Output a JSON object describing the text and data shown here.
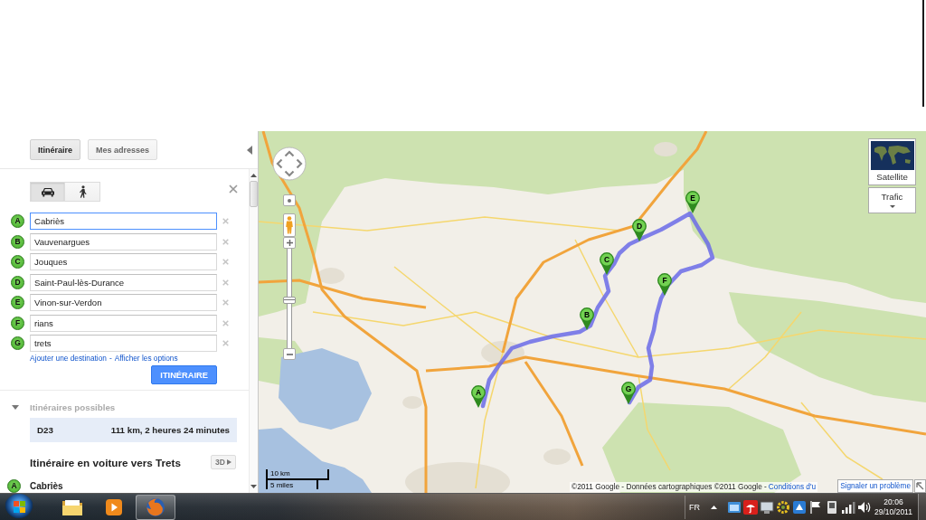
{
  "sidebar": {
    "tabs": [
      {
        "label": "Itinéraire",
        "selected": true
      },
      {
        "label": "Mes adresses",
        "selected": false
      }
    ],
    "travel_modes": [
      {
        "kind": "car",
        "selected": true
      },
      {
        "kind": "walk",
        "selected": false
      }
    ],
    "waypoints": [
      {
        "marker": "A",
        "value": "Cabriès",
        "focused": true
      },
      {
        "marker": "B",
        "value": "Vauvenargues",
        "focused": false
      },
      {
        "marker": "C",
        "value": "Jouques",
        "focused": false
      },
      {
        "marker": "D",
        "value": "Saint-Paul-lès-Durance",
        "focused": false
      },
      {
        "marker": "E",
        "value": "Vinon-sur-Verdon",
        "focused": false
      },
      {
        "marker": "F",
        "value": "rians",
        "focused": false
      },
      {
        "marker": "G",
        "value": "trets",
        "focused": false
      }
    ],
    "add_destination_link": "Ajouter une destination",
    "link_separator": "-",
    "options_link": "Afficher les options",
    "submit_button": "ITINÉRAIRE",
    "routes_section": {
      "title": "Itinéraires possibles",
      "expanded": true,
      "routes": [
        {
          "name": "D23",
          "summary": "111 km, 2 heures 24 minutes",
          "selected": true
        }
      ]
    },
    "directions": {
      "title": "Itinéraire en voiture vers Trets",
      "view_3d_button": "3D",
      "steps": [
        {
          "marker": "A",
          "place": "Cabriès"
        }
      ]
    }
  },
  "map": {
    "markers": [
      {
        "label": "A"
      },
      {
        "label": "B"
      },
      {
        "label": "C"
      },
      {
        "label": "D"
      },
      {
        "label": "E"
      },
      {
        "label": "F"
      },
      {
        "label": "G"
      }
    ],
    "zoom": {
      "level": 0.48
    },
    "map_type": {
      "satellite": "Satellite",
      "traffic": "Trafic"
    },
    "scale": {
      "metric": "10 km",
      "imperial": "5 miles"
    },
    "attribution": "©2011 Google - Données cartographiques ©2011 Google -",
    "terms_link": "Conditions d'u",
    "report_link": "Signaler un problème"
  },
  "taskbar": {
    "apps": [
      {
        "kind": "explorer",
        "active": false
      },
      {
        "kind": "media_player",
        "active": false
      },
      {
        "kind": "browser",
        "active": true
      }
    ],
    "language": "FR",
    "time": "20:06",
    "date": "29/10/2011"
  }
}
